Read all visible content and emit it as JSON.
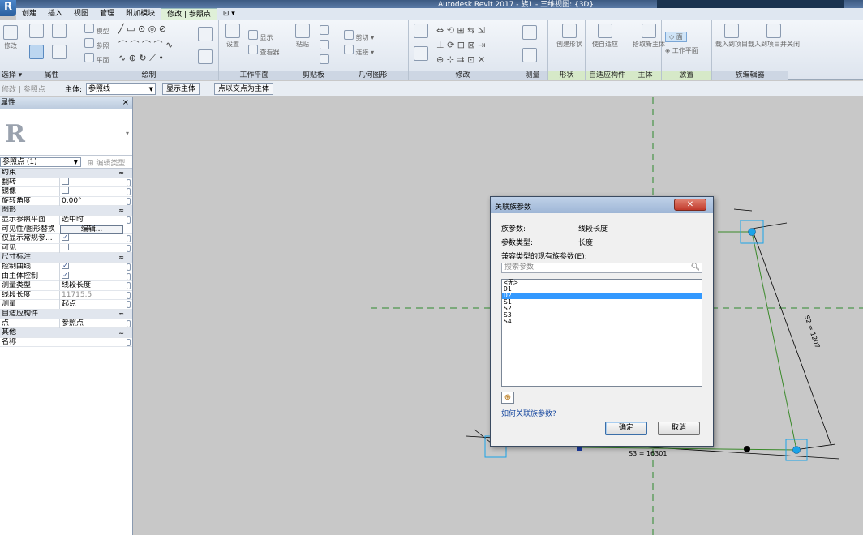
{
  "window": {
    "title": "Autodesk Revit 2017 -    族1 - 三维视图: {3D}",
    "app_letter": "R"
  },
  "ribbon": {
    "tabs": [
      {
        "label": "创建"
      },
      {
        "label": "插入"
      },
      {
        "label": "视图"
      },
      {
        "label": "管理"
      },
      {
        "label": "附加模块"
      },
      {
        "label": "修改 | 参照点"
      },
      {
        "label": "⊡ ▾"
      }
    ],
    "panels": {
      "select": "选择 ▾",
      "properties": "属性",
      "draw": "绘制",
      "workplane": "工作平面",
      "clipboard": "剪贴板",
      "geometry": "几何图形",
      "modify": "修改",
      "measure": "测量",
      "shape": "形状",
      "adaptive": "自适应构件",
      "host": "主体",
      "placement": "放置",
      "family_editor": "族编辑器"
    },
    "buttons": {
      "modify": "修改",
      "model": "模型",
      "ref": "参照",
      "plane": "平面",
      "set": "设置",
      "show": "显示",
      "viewer": "查看器",
      "paste": "粘贴",
      "cut": "剪切",
      "join": "连接",
      "create_form": "创建形状",
      "make_adaptive": "使自适应",
      "pick_new_host": "拾取新主体",
      "face": "面",
      "work_plane": "工作平面",
      "load_into_project": "载入到项目",
      "load_into_project_close": "载入到项目并关闭"
    }
  },
  "options_bar": {
    "context": "修改 | 参照点",
    "host_label": "主体:",
    "host_value": "参照线",
    "show_host": "显示主体",
    "intersect_host": "点以交点为主体"
  },
  "properties": {
    "header": "属性",
    "close": "×",
    "type_glyph": "R",
    "type_selector": "参照点 (1)",
    "edit_type": "编辑类型",
    "rows": [
      {
        "kind": "group",
        "name": "约束"
      },
      {
        "kind": "check",
        "name": "翻转",
        "checked": false
      },
      {
        "kind": "check",
        "name": "镜像",
        "checked": false
      },
      {
        "kind": "value",
        "name": "旋转角度",
        "value": "0.00°"
      },
      {
        "kind": "group",
        "name": "图形"
      },
      {
        "kind": "value",
        "name": "显示参照平面",
        "value": "选中时"
      },
      {
        "kind": "button",
        "name": "可见性/图形替换",
        "value": "编辑..."
      },
      {
        "kind": "check",
        "name": "仅显示常规参...",
        "checked": true
      },
      {
        "kind": "check",
        "name": "可见",
        "checked": false
      },
      {
        "kind": "group",
        "name": "尺寸标注"
      },
      {
        "kind": "check",
        "name": "控制曲线",
        "checked": true
      },
      {
        "kind": "check",
        "name": "由主体控制",
        "checked": true
      },
      {
        "kind": "value",
        "name": "测量类型",
        "value": "线段长度"
      },
      {
        "kind": "value",
        "name": "线段长度",
        "value": "11715.5",
        "disabled": true
      },
      {
        "kind": "value",
        "name": "测量",
        "value": "起点"
      },
      {
        "kind": "group",
        "name": "自适应构件"
      },
      {
        "kind": "value",
        "name": "点",
        "value": "参照点"
      },
      {
        "kind": "group",
        "name": "其他"
      },
      {
        "kind": "value",
        "name": "名称",
        "value": ""
      }
    ]
  },
  "canvas": {
    "dim_s2": "S2 = 1207",
    "dim_s3": "S3 = 16301"
  },
  "dialog": {
    "title": "关联族参数",
    "close": "✕",
    "family_param_label": "族参数:",
    "family_param_value": "线段长度",
    "param_type_label": "参数类型:",
    "param_type_value": "长度",
    "compatible_label": "兼容类型的现有族参数(E):",
    "search_placeholder": "搜索参数",
    "items": [
      "<无>",
      "D1",
      "D2",
      "S1",
      "S2",
      "S3",
      "S4"
    ],
    "selected_index": 2,
    "add_param": "⊕",
    "help_link": "如何关联族参数?",
    "ok": "确定",
    "cancel": "取消"
  },
  "colors": {
    "accent": "#3399ff",
    "point": "#1aa3e8",
    "shape_line": "#3a8a2a"
  }
}
